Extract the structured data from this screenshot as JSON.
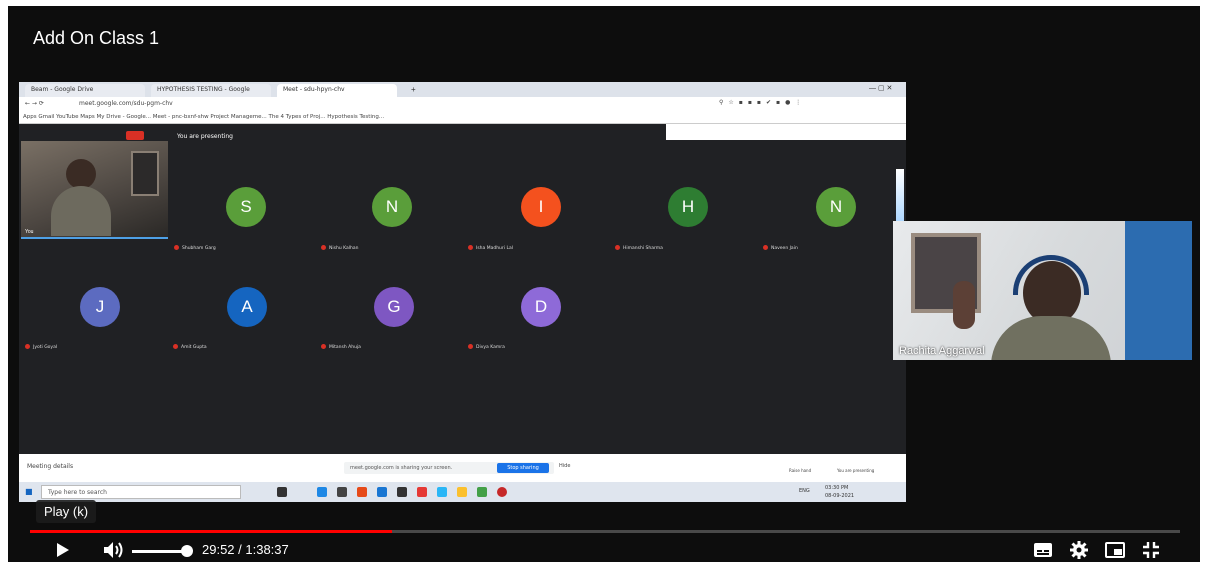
{
  "video": {
    "title": "Add On Class 1",
    "tooltip": "Play (k)",
    "current_time": "29:52",
    "duration": "1:38:37",
    "time_display": "29:52 / 1:38:37",
    "progress_fraction": 0.315,
    "volume_fraction": 1.0
  },
  "browser": {
    "tabs": [
      {
        "label": "Beam - Google Drive"
      },
      {
        "label": "HYPOTHESIS TESTING - Google"
      },
      {
        "label": "Meet - sdu-hpyn-chv"
      }
    ],
    "url": "meet.google.com/sdu-pgm-chv",
    "bookmarks": "Apps   Gmail   YouTube   Maps   My Drive - Google...   Meet - pnc-bxnf-shw   Project Manageme...   The 4 Types of Proj...   Hypothesis Testing..."
  },
  "meet": {
    "presenting_text": "You are presenting",
    "self_label": "You",
    "participants": [
      {
        "initial": "S",
        "name": "Shubham Garg",
        "color": "#5a9e3a"
      },
      {
        "initial": "N",
        "name": "Nishu Kalhan",
        "color": "#5a9e3a"
      },
      {
        "initial": "I",
        "name": "Isha Madhuri Lal",
        "color": "#f4511e"
      },
      {
        "initial": "H",
        "name": "Himanshi Sharma",
        "color": "#2e7d32"
      },
      {
        "initial": "N",
        "name": "Naveen Jain",
        "color": "#5a9e3a"
      },
      {
        "initial": "J",
        "name": "Jyoti Goyal",
        "color": "#5c6bc0"
      },
      {
        "initial": "A",
        "name": "Amit Gupta",
        "color": "#1565c0"
      },
      {
        "initial": "G",
        "name": "Mitansh Ahuja",
        "color": "#7e57c2"
      },
      {
        "initial": "D",
        "name": "Divya Kamra",
        "color": "#8e6ad8"
      }
    ],
    "meeting_details": "Meeting details",
    "share_banner": "meet.google.com is sharing your screen.",
    "stop_sharing": "Stop sharing",
    "hide": "Hide",
    "raise_hand": "Raise hand",
    "presenting_label": "You are presenting"
  },
  "taskbar": {
    "search_placeholder": "Type here to search",
    "clock_time": "03:30 PM",
    "clock_date": "08-09-2021",
    "lang": "ENG"
  },
  "presenter": {
    "name": "Rachita Aggarwal"
  }
}
